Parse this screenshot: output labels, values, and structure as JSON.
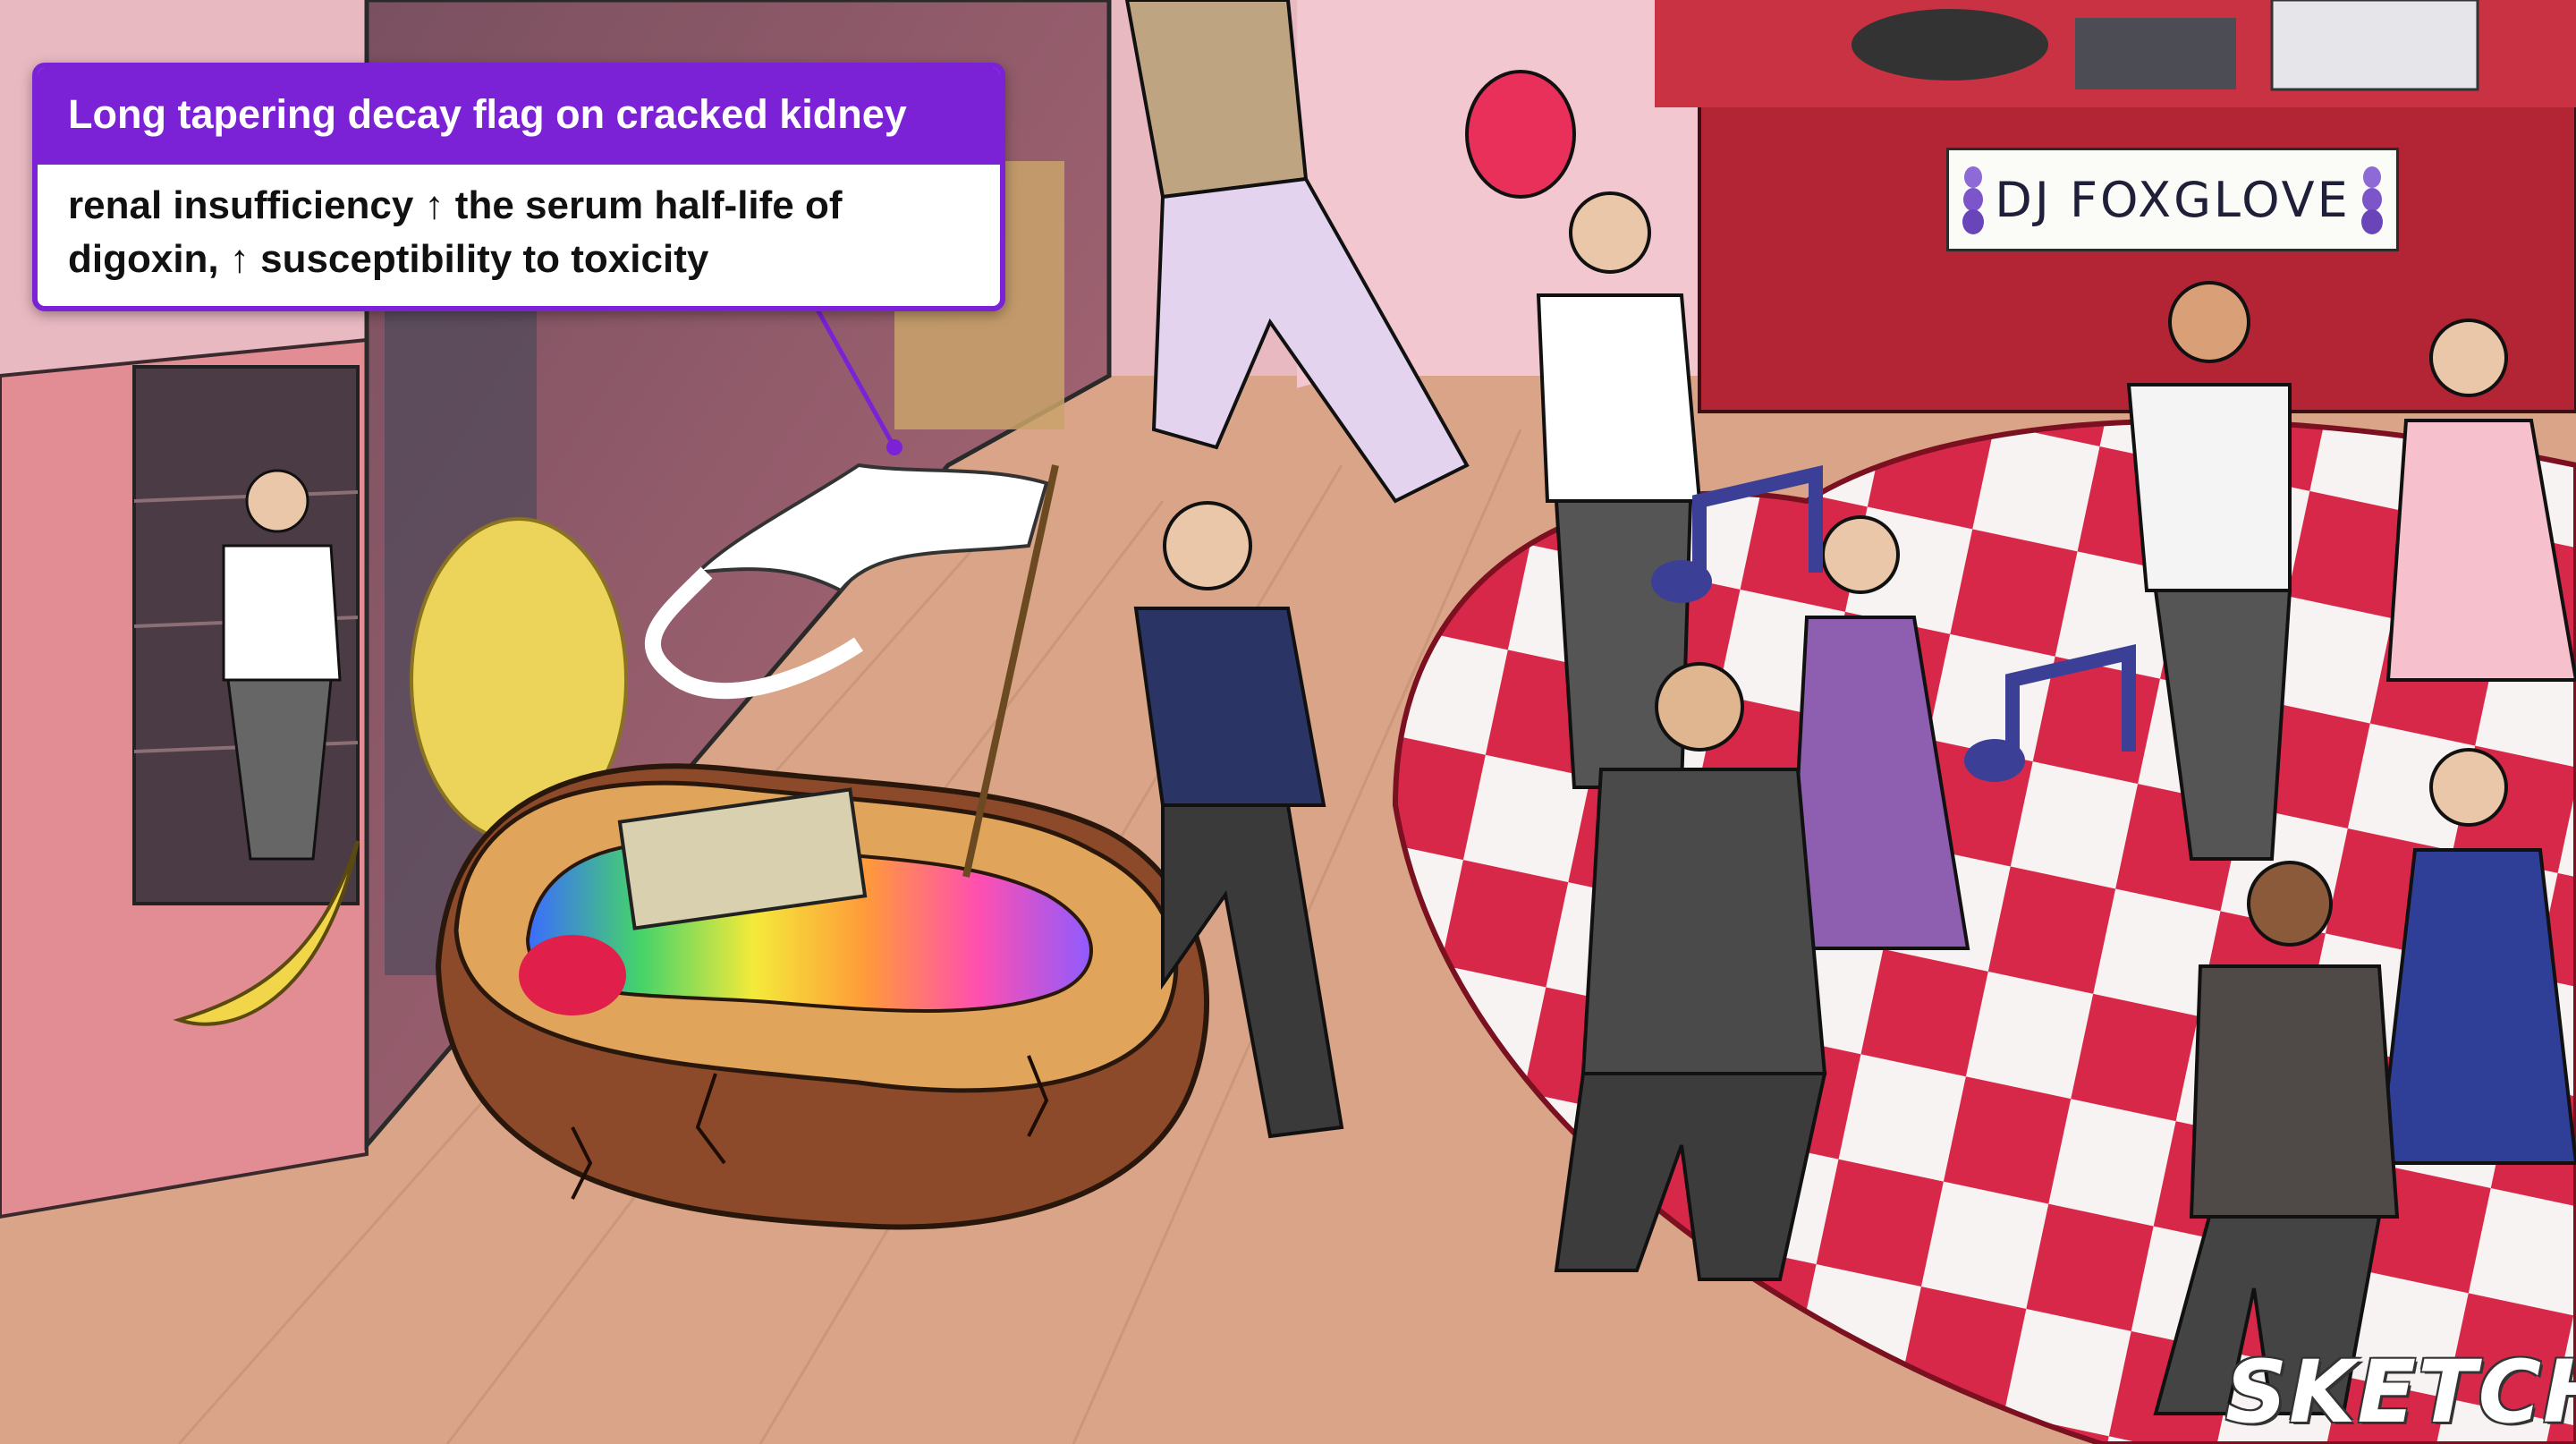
{
  "callout": {
    "title": "Long tapering decay flag on cracked kidney",
    "body": "renal insufficiency ↑ the serum half-life of digoxin, ↑ susceptibility to toxicity"
  },
  "scene": {
    "dj_sign": "DJ FOXGLOVE",
    "logo": "SKETCHY"
  },
  "colors": {
    "accent": "#7b22d6",
    "floor": "#d9a487",
    "dance_red": "#d8284a",
    "dance_white": "#f7f3f3"
  }
}
